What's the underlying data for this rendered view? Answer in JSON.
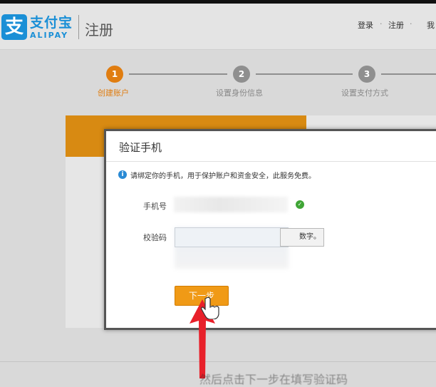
{
  "header": {
    "logo_mark": "支",
    "logo_cn": "支付宝",
    "logo_en": "ALIPAY",
    "page_title": "注册",
    "nav": [
      "登录",
      "注册",
      "我"
    ]
  },
  "steps": [
    {
      "number": "1",
      "label": "创建账户",
      "active": true
    },
    {
      "number": "2",
      "label": "设置身份信息",
      "active": false
    },
    {
      "number": "3",
      "label": "设置支付方式",
      "active": false
    }
  ],
  "modal": {
    "title": "验证手机",
    "notice": "请绑定你的手机，用于保护账户和资金安全，此服务免费。",
    "phone_label": "手机号",
    "code_label": "校验码",
    "send_button_visible": "数字。",
    "next_button": "下一步"
  },
  "overlay_text": "然后点击下一步在填写验证码",
  "colors": {
    "accent": "#f09a16",
    "brand": "#1a8fd6",
    "step_active": "#e07d10",
    "step_inactive": "#8f8f8f",
    "arrow": "#e8202a"
  },
  "icons": {
    "info": "info-icon",
    "check": "check-icon",
    "cursor": "hand-cursor-icon",
    "arrow": "red-arrow-icon"
  }
}
